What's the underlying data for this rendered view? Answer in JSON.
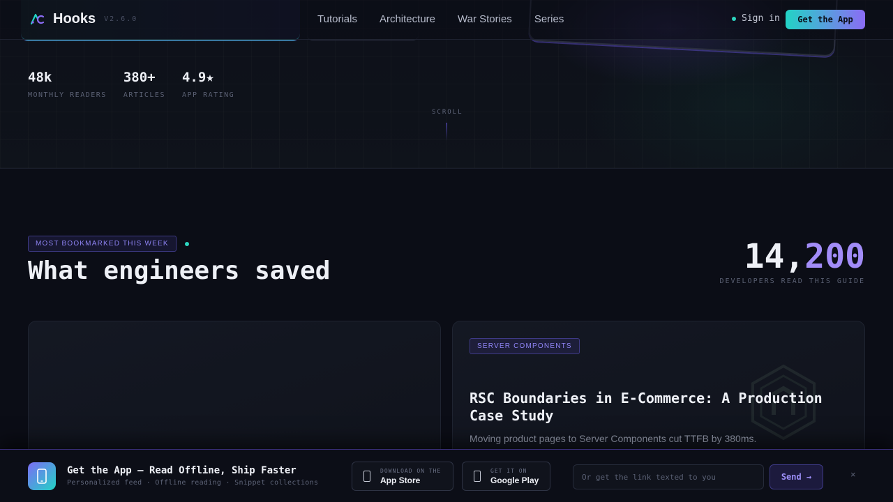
{
  "nav": {
    "logo": "Hooks",
    "version": "V2.6.0",
    "links": [
      "Tutorials",
      "Architecture",
      "War Stories",
      "Series"
    ],
    "sign_in": "Sign in",
    "cta": "Get the App"
  },
  "hero": {
    "stats": [
      {
        "value": "48k",
        "label": "MONTHLY READERS"
      },
      {
        "value": "380+",
        "label": "ARTICLES"
      },
      {
        "value": "4.9★",
        "label": "APP RATING"
      }
    ],
    "scroll": "SCROLL"
  },
  "section": {
    "badge": "MOST BOOKMARKED THIS WEEK",
    "title": "What engineers saved",
    "count_part1": "14,",
    "count_part2": "200",
    "count_label": "DEVELOPERS READ THIS GUIDE"
  },
  "card": {
    "tag": "SERVER COMPONENTS",
    "title": "RSC Boundaries in E-Commerce: A Production Case Study",
    "description": "Moving product pages to Server Components cut TTFB by 380ms."
  },
  "banner": {
    "title": "Get the App — Read Offline, Ship Faster",
    "subtitle": "Personalized feed · Offline reading · Snippet collections",
    "app_store_small": "DOWNLOAD ON THE",
    "app_store_big": "App Store",
    "google_small": "GET IT ON",
    "google_big": "Google Play",
    "input_placeholder": "Or get the link texted to you",
    "send": "Send →",
    "close": "×"
  },
  "colors": {
    "accent_teal": "#22d3c5",
    "accent_violet": "#8b6cf5",
    "background": "#0b0d16"
  }
}
